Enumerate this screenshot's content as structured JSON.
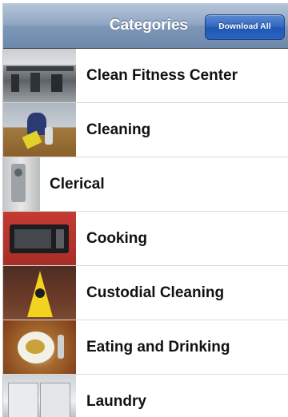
{
  "navbar": {
    "title": "Categories",
    "download_all_label": "Download All"
  },
  "categories": [
    {
      "label": "Clean Fitness Center"
    },
    {
      "label": "Cleaning"
    },
    {
      "label": "Clerical"
    },
    {
      "label": "Cooking"
    },
    {
      "label": "Custodial Cleaning"
    },
    {
      "label": "Eating and Drinking"
    },
    {
      "label": "Laundry"
    }
  ]
}
